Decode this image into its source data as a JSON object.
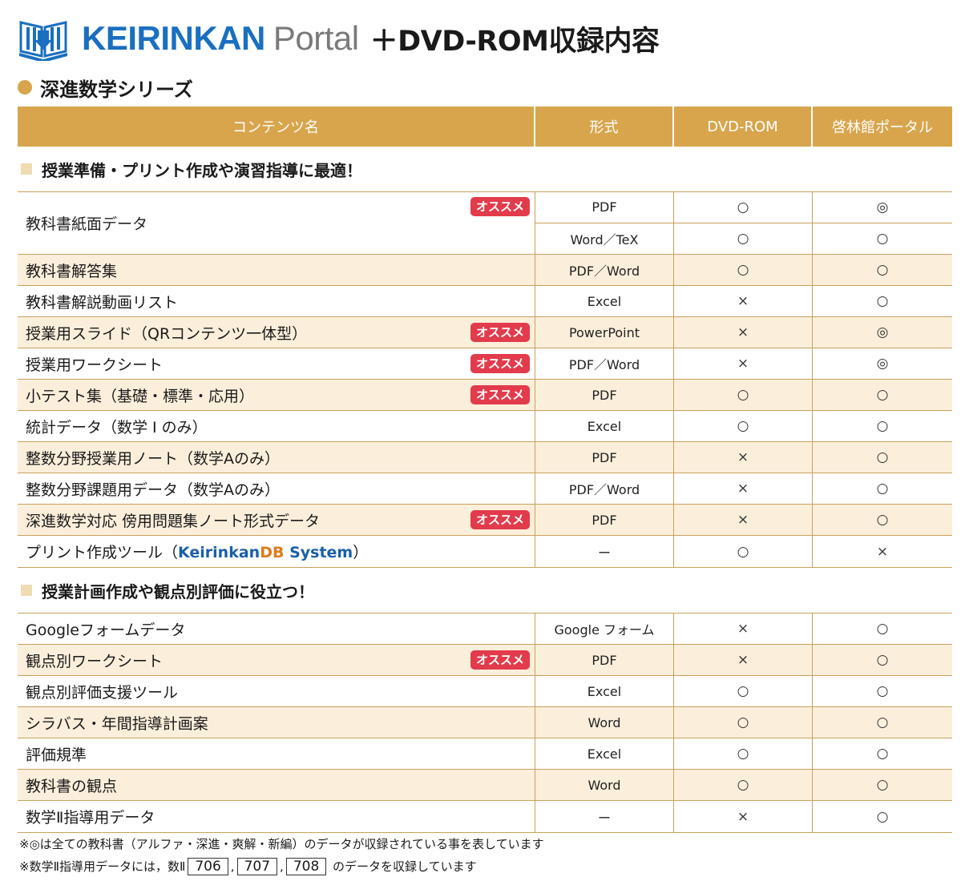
{
  "header": {
    "brand_main": "KEIRINKAN",
    "brand_sub": "Portal",
    "suffix": "＋DVD-ROM収録内容"
  },
  "series_title": "深進数学シリーズ",
  "table_headers": [
    "コンテンツ名",
    "形式",
    "DVD-ROM",
    "啓林館ポータル"
  ],
  "badge_label": "オススメ",
  "section1": {
    "title": "授業準備・プリント作成や演習指導に最適！",
    "first": {
      "name": "教科書紙面データ",
      "subs": [
        {
          "format": "PDF",
          "dvd": "○",
          "portal": "◎"
        },
        {
          "format": "Word／TeX",
          "dvd": "○",
          "portal": "○"
        }
      ]
    },
    "rows": [
      {
        "name": "教科書解答集",
        "format": "PDF／Word",
        "dvd": "○",
        "portal": "○",
        "badge": false
      },
      {
        "name": "教科書解説動画リスト",
        "format": "Excel",
        "dvd": "×",
        "portal": "○",
        "badge": false
      },
      {
        "name": "授業用スライド（QRコンテンツ一体型）",
        "format": "PowerPoint",
        "dvd": "×",
        "portal": "◎",
        "badge": true
      },
      {
        "name": "授業用ワークシート",
        "format": "PDF／Word",
        "dvd": "×",
        "portal": "◎",
        "badge": true
      },
      {
        "name": "小テスト集（基礎・標準・応用）",
        "format": "PDF",
        "dvd": "○",
        "portal": "○",
        "badge": true
      },
      {
        "name": "統計データ（数学 I のみ）",
        "format": "Excel",
        "dvd": "○",
        "portal": "○",
        "badge": false
      },
      {
        "name": "整数分野授業用ノート（数学Aのみ）",
        "format": "PDF",
        "dvd": "×",
        "portal": "○",
        "badge": false
      },
      {
        "name": "整数分野課題用データ（数学Aのみ）",
        "format": "PDF／Word",
        "dvd": "×",
        "portal": "○",
        "badge": false
      },
      {
        "name": "深進数学対応 傍用問題集ノート形式データ",
        "format": "PDF",
        "dvd": "×",
        "portal": "○",
        "badge": true
      }
    ],
    "last": {
      "name_prefix": "プリント作成ツール（",
      "kdb_a": "Keirinkan",
      "kdb_b": "DB",
      "kdb_c": " System",
      "name_suffix": "）",
      "format": "ー",
      "dvd": "○",
      "portal": "×"
    }
  },
  "section2": {
    "title": "授業計画作成や観点別評価に役立つ！",
    "rows": [
      {
        "name": "Googleフォームデータ",
        "format": "Google フォーム",
        "dvd": "×",
        "portal": "○",
        "badge": false
      },
      {
        "name": "観点別ワークシート",
        "format": "PDF",
        "dvd": "×",
        "portal": "○",
        "badge": true
      },
      {
        "name": "観点別評価支援ツール",
        "format": "Excel",
        "dvd": "○",
        "portal": "○",
        "badge": false
      },
      {
        "name": "シラバス・年間指導計画案",
        "format": "Word",
        "dvd": "○",
        "portal": "○",
        "badge": false
      },
      {
        "name": "評価規準",
        "format": "Excel",
        "dvd": "○",
        "portal": "○",
        "badge": false
      },
      {
        "name": "教科書の観点",
        "format": "Word",
        "dvd": "○",
        "portal": "○",
        "badge": false
      },
      {
        "name": "数学Ⅱ指導用データ",
        "format": "ー",
        "dvd": "×",
        "portal": "○",
        "badge": false
      }
    ]
  },
  "notes": {
    "line1": "※◎は全ての教科書（アルファ・深進・爽解・新編）のデータが収録されている事を表しています",
    "line2_prefix": "※数学Ⅱ指導用データには，数Ⅱ",
    "numbers": [
      "706",
      "707",
      "708"
    ],
    "line2_suffix": "のデータを収録しています"
  }
}
